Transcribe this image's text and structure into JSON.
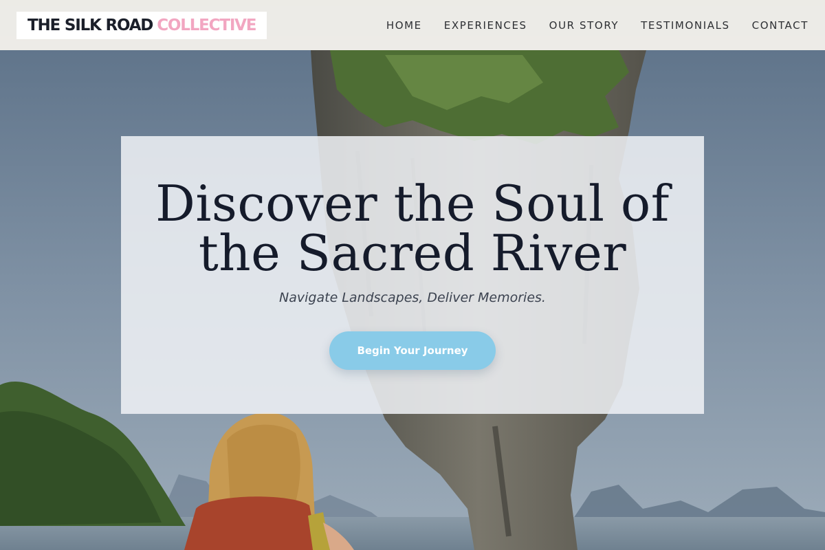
{
  "brand": {
    "name_main": "THE SILK ROAD",
    "name_accent": "COLLECTIVE",
    "accent_color": "#f2a6c1"
  },
  "nav": {
    "items": [
      {
        "label": "HOME"
      },
      {
        "label": "EXPERIENCES"
      },
      {
        "label": "OUR STORY"
      },
      {
        "label": "TESTIMONIALS"
      },
      {
        "label": "CONTACT"
      }
    ]
  },
  "hero": {
    "title_line1": "Discover the Soul of",
    "title_line2": "the Sacred River",
    "subtitle": "Navigate Landscapes, Deliver Memories.",
    "cta_label": "Begin Your Journey",
    "cta_color": "#89cbe8"
  }
}
